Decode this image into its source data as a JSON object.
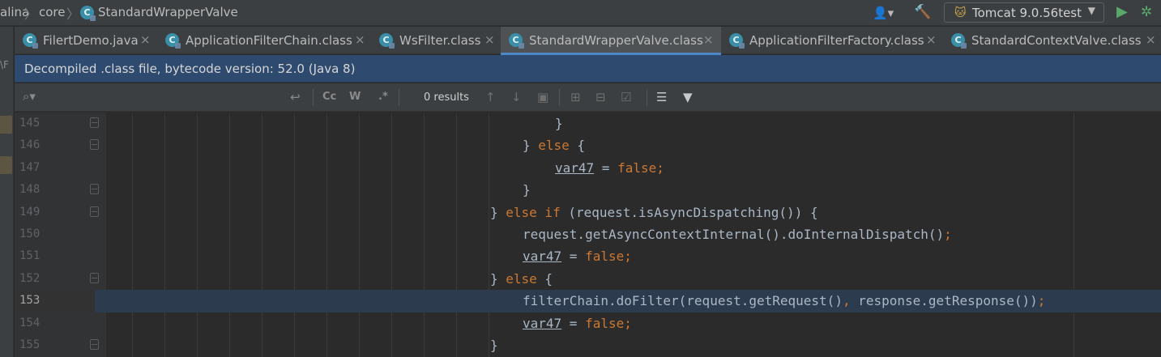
{
  "breadcrumbs": [
    "alina",
    "core",
    "StandardWrapperValve"
  ],
  "run_config": {
    "label": "Tomcat 9.0.56test"
  },
  "icons": {
    "user": "user-icon",
    "build": "hammer-icon",
    "tomcat": "tomcat-icon",
    "run": "run-icon",
    "debug": "debug-icon",
    "class": "class-file-icon"
  },
  "tabs": [
    {
      "label": "FilertDemo.java",
      "close": "×"
    },
    {
      "label": "ApplicationFilterChain.class",
      "close": "×"
    },
    {
      "label": "WsFilter.class",
      "close": "×"
    },
    {
      "label": "StandardWrapperValve.class",
      "close": "×",
      "active": true
    },
    {
      "label": "ApplicationFilterFactory.class",
      "close": "×"
    },
    {
      "label": "StandardContextValve.class",
      "close": "×"
    }
  ],
  "banner": {
    "text": "Decompiled .class file, bytecode version: 52.0 (Java 8)"
  },
  "find": {
    "search_icon": "Q",
    "case_label": "Cc",
    "words_label": "W",
    "regex_label": ".*",
    "results": "0 results"
  },
  "left_hint": "\\F",
  "lines": [
    {
      "num": "145",
      "code": "}"
    },
    {
      "num": "146",
      "code": "} else {"
    },
    {
      "num": "147",
      "code": "var47 = false;"
    },
    {
      "num": "148",
      "code": "}"
    },
    {
      "num": "149",
      "code": "} else if (request.isAsyncDispatching()) {"
    },
    {
      "num": "150",
      "code": "request.getAsyncContextInternal().doInternalDispatch();"
    },
    {
      "num": "151",
      "code": "var47 = false;"
    },
    {
      "num": "152",
      "code": "} else {"
    },
    {
      "num": "153",
      "code": "filterChain.doFilter(request.getRequest(), response.getResponse());",
      "current": true
    },
    {
      "num": "154",
      "code": "var47 = false;"
    },
    {
      "num": "155",
      "code": "}"
    }
  ],
  "colors": {
    "keyword": "#cc7832",
    "text": "#a9b7c6",
    "current_line": "#2d3b4e",
    "banner": "#2e4a6e",
    "accent": "#4a88c7",
    "run": "#59a869"
  }
}
